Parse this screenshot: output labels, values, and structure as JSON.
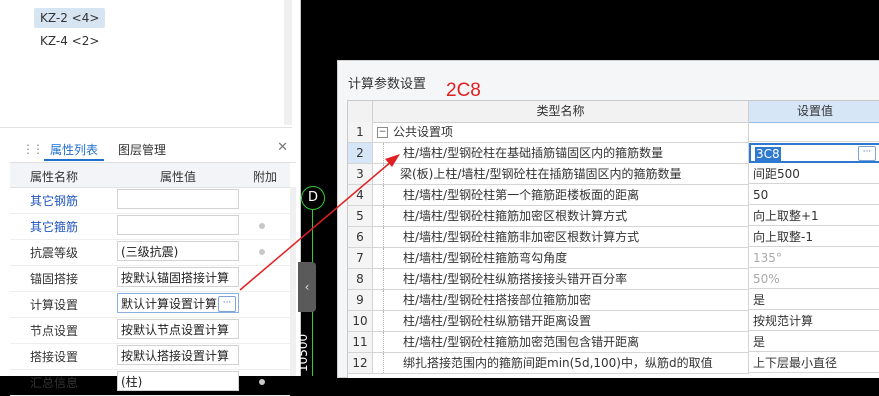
{
  "tree": {
    "items": [
      {
        "label": "KZ-2 <4>",
        "selected": true
      },
      {
        "label": "KZ-4 <2>",
        "selected": false
      }
    ]
  },
  "properties_panel": {
    "tabs": [
      "属性列表",
      "图层管理"
    ],
    "active_tab": "属性列表",
    "columns": [
      "属性名称",
      "属性值",
      "附加"
    ],
    "rows": [
      {
        "name": "其它钢筋",
        "value": "",
        "link": true
      },
      {
        "name": "其它箍筋",
        "value": "",
        "link": true
      },
      {
        "name": "抗震等级",
        "value": "(三级抗震)",
        "link": false
      },
      {
        "name": "锚固搭接",
        "value": "按默认锚固搭接计算",
        "link": false
      },
      {
        "name": "计算设置",
        "value": "默认计算设置计算",
        "link": false
      },
      {
        "name": "节点设置",
        "value": "按默认节点设置计算",
        "link": false
      },
      {
        "name": "搭接设置",
        "value": "按默认搭接设置计算",
        "link": false
      },
      {
        "name": "汇总信息",
        "value": "(柱)",
        "link": false
      }
    ],
    "ellipsis": "···"
  },
  "canvas": {
    "axis_label": "D",
    "dimension_text": "10500",
    "collapse_glyph": "‹"
  },
  "dialog": {
    "title": "计算参数设置",
    "columns": [
      "类型名称",
      "设置值"
    ],
    "group_title": "公共设置项",
    "group_toggle": "−",
    "editing_value": "3C8",
    "annotation": "2C8",
    "rows": [
      {
        "num": "1",
        "type": "公共设置项",
        "value": ""
      },
      {
        "num": "2",
        "type": "柱/墙柱/型钢砼柱在基础插筋锚固区内的箍筋数量",
        "value": "3C8"
      },
      {
        "num": "3",
        "type": "梁(板)上柱/墙柱/型钢砼柱在插筋锚固区内的箍筋数量",
        "value": "间距500"
      },
      {
        "num": "4",
        "type": "柱/墙柱/型钢砼柱第一个箍筋距楼板面的距离",
        "value": "50"
      },
      {
        "num": "5",
        "type": "柱/墙柱/型钢砼柱箍筋加密区根数计算方式",
        "value": "向上取整+1"
      },
      {
        "num": "6",
        "type": "柱/墙柱/型钢砼柱箍筋非加密区根数计算方式",
        "value": "向上取整-1"
      },
      {
        "num": "7",
        "type": "柱/墙柱/型钢砼柱箍筋弯勾角度",
        "value": "135°"
      },
      {
        "num": "8",
        "type": "柱/墙柱/型钢砼柱纵筋搭接接头错开百分率",
        "value": "50%"
      },
      {
        "num": "9",
        "type": "柱/墙柱/型钢砼柱搭接部位箍筋加密",
        "value": "是"
      },
      {
        "num": "10",
        "type": "柱/墙柱/型钢砼柱纵筋错开距离设置",
        "value": "按规范计算"
      },
      {
        "num": "11",
        "type": "柱/墙柱/型钢砼柱箍筋加密范围包含错开距离",
        "value": "是"
      },
      {
        "num": "12",
        "type": "绑扎搭接范围内的箍筋间距min(5d,100)中，纵筋d的取值",
        "value": "上下层最小直径"
      }
    ]
  },
  "colors": {
    "accent": "#1f6fd0",
    "annotation": "#e02020",
    "axis": "#33cc33"
  }
}
